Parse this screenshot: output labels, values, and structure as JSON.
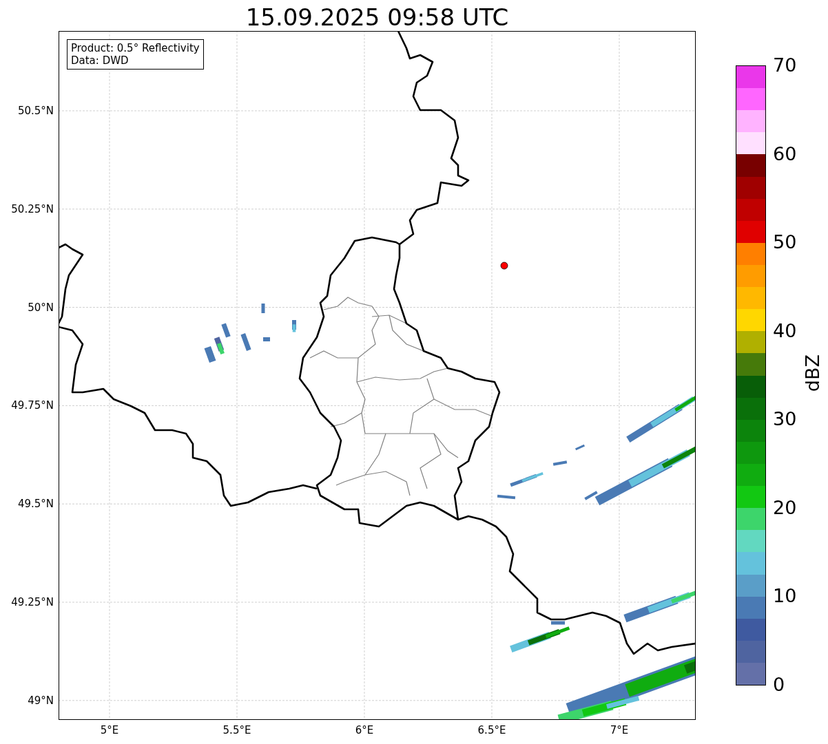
{
  "title": "15.09.2025 09:58 UTC",
  "annotation": [
    "Product: 0.5° Reflectivity",
    "Data: DWD"
  ],
  "y_ticks": [
    "50.5°N",
    "50.25°N",
    "50°N",
    "49.75°N",
    "49.5°N",
    "49.25°N",
    "49°N"
  ],
  "x_ticks": [
    "5°E",
    "5.5°E",
    "6°E",
    "6.5°E",
    "7°E"
  ],
  "colorbar": {
    "label": "dBZ",
    "ticks": [
      "70",
      "60",
      "50",
      "40",
      "30",
      "20",
      "10",
      "0"
    ],
    "bands": [
      {
        "color": "#ea37ea"
      },
      {
        "color": "#ff66ff"
      },
      {
        "color": "#ffb3ff"
      },
      {
        "color": "#ffe0ff"
      },
      {
        "color": "#780000"
      },
      {
        "color": "#a00000"
      },
      {
        "color": "#c00000"
      },
      {
        "color": "#e00000"
      },
      {
        "color": "#ff7f00"
      },
      {
        "color": "#ff9c00"
      },
      {
        "color": "#ffb800"
      },
      {
        "color": "#ffd700"
      },
      {
        "color": "#b0b000"
      },
      {
        "color": "#467a0a"
      },
      {
        "color": "#085e08"
      },
      {
        "color": "#0a700a"
      },
      {
        "color": "#0c840c"
      },
      {
        "color": "#0e980e"
      },
      {
        "color": "#10ac10"
      },
      {
        "color": "#12c812"
      },
      {
        "color": "#3dd56b"
      },
      {
        "color": "#62d8c0"
      },
      {
        "color": "#64c2dc"
      },
      {
        "color": "#5a9ec8"
      },
      {
        "color": "#4a7ab4"
      },
      {
        "color": "#3f5aa0"
      },
      {
        "color": "#4f64a0"
      },
      {
        "color": "#6470a8"
      }
    ]
  }
}
